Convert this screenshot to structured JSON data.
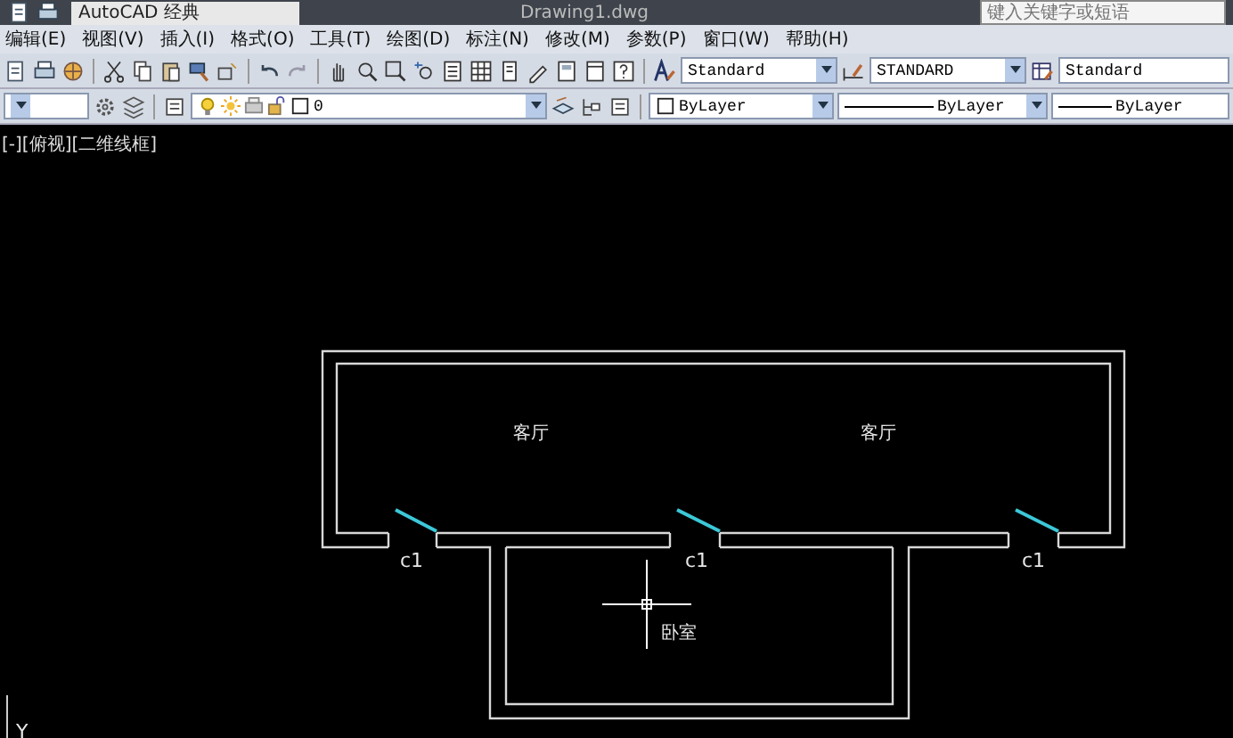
{
  "title_bar": {
    "workspace": "AutoCAD 经典",
    "document_title": "Drawing1.dwg",
    "search_placeholder": "键入关键字或短语"
  },
  "menu_bar": {
    "items": [
      "编辑(E)",
      "视图(V)",
      "插入(I)",
      "格式(O)",
      "工具(T)",
      "绘图(D)",
      "标注(N)",
      "修改(M)",
      "参数(P)",
      "窗口(W)",
      "帮助(H)"
    ]
  },
  "styles_toolbar": {
    "text_style": "Standard",
    "dimension_style": "STANDARD",
    "table_style": "Standard"
  },
  "properties_toolbar": {
    "layer": "0",
    "color_setting": "ByLayer",
    "linetype": "ByLayer",
    "lineweight": "ByLayer"
  },
  "viewport": {
    "label": "[-][俯视][二维线框]",
    "rooms": [
      "客厅",
      "客厅",
      "卧室"
    ],
    "windows": [
      "c1",
      "c1",
      "c1"
    ],
    "ucs_axis": "Y"
  }
}
